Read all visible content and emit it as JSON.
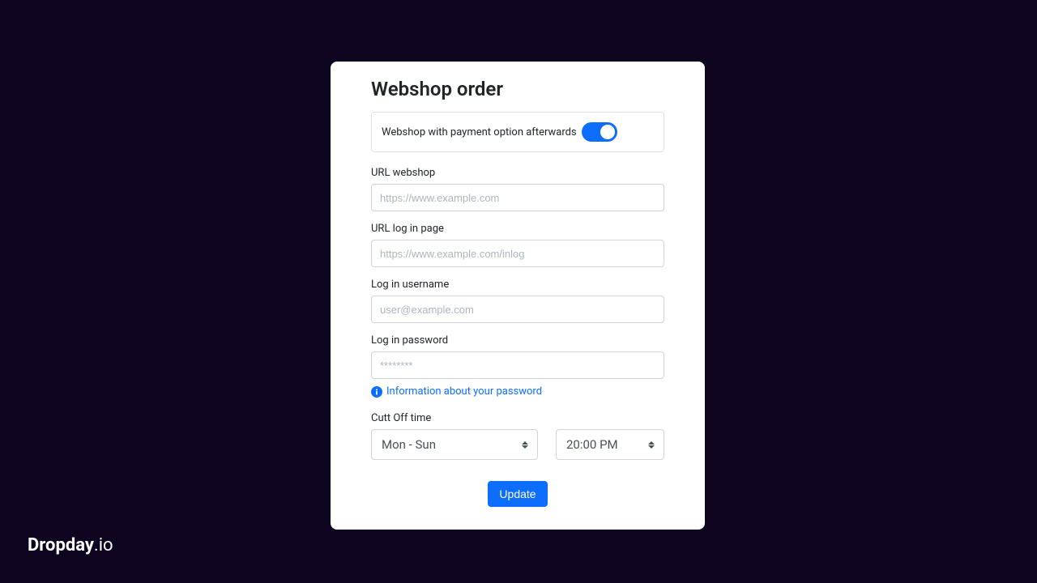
{
  "card": {
    "title": "Webshop order",
    "toggle": {
      "label": "Webshop with payment option afterwards",
      "on": true
    },
    "fields": {
      "url_webshop": {
        "label": "URL webshop",
        "placeholder": "https://www.example.com",
        "value": ""
      },
      "url_login": {
        "label": "URL log in page",
        "placeholder": "https://www.example.com/inlog",
        "value": ""
      },
      "username": {
        "label": "Log in username",
        "placeholder": "user@example.com",
        "value": ""
      },
      "password": {
        "label": "Log in password",
        "placeholder": "********",
        "value": "",
        "info_link": "Information about your password"
      },
      "cutoff": {
        "label": "Cutt Off time",
        "days_value": "Mon - Sun",
        "time_value": "20:00 PM"
      }
    },
    "submit_label": "Update"
  },
  "brand": {
    "bold": "Dropday",
    "thin": ".io"
  }
}
